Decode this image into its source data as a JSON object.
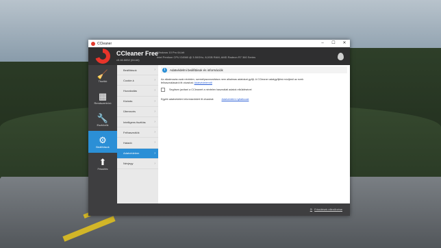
{
  "window": {
    "title": "CCleaner",
    "minimize": "–",
    "maximize": "☐",
    "close": "✕"
  },
  "header": {
    "app_title": "CCleaner Free",
    "version": "v5.46.6652 (64-bit)",
    "sys_line1": "Windows 10 Pro 64-bit",
    "sys_line2": "Intel Pentium CPU G4560 @ 3.50GHz, 8,0GB RAM, AMD Radeon R7 360 Series"
  },
  "sidebar": {
    "items": [
      {
        "label": "Tisztító",
        "icon": "broom-icon"
      },
      {
        "label": "Rendszerleíró",
        "icon": "grid-icon"
      },
      {
        "label": "Eszközök",
        "icon": "wrench-icon"
      },
      {
        "label": "Beállítások",
        "icon": "gear-icon"
      },
      {
        "label": "Frissítés",
        "icon": "up-arrow-icon"
      }
    ],
    "active_index": 3
  },
  "subnav": {
    "items": [
      "Beállítások",
      "Cookie-k",
      "Hozzáadás",
      "Kizárás",
      "Ütemezés",
      "Intelligens tisztítás",
      "Felhasználók",
      "Haladó",
      "Adatvédelem",
      "Névjegy"
    ],
    "active_index": 8
  },
  "content": {
    "section_title": "Adatvédelmi beállítások és információk",
    "para_text": "Az alkalmazás csak névtelen, személyazonosításra nem alkalmas adatokat gyűjt. A CCleaner adatgyűjtési módjáról az ezek felhasználásáról itt olvashat:",
    "para_link": "Adatvédelemről",
    "checkbox_label": "Segítsen javítani a CCleanert a névtelen használati adatok elküldésével",
    "more_text": "Egyéb adatvédelmi információkért itt olvashat:",
    "more_link": "Adatvédelmi nyilatkozat"
  },
  "bottom": {
    "update_label": "Frissítések ellenőrzése"
  }
}
